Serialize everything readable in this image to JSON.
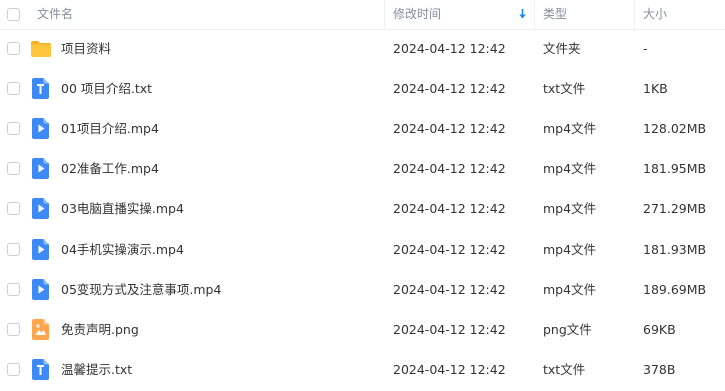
{
  "columns": {
    "name": "文件名",
    "modified": "修改时间",
    "type": "类型",
    "size": "大小"
  },
  "sort": {
    "column": "modified",
    "icon": "sort-down-arrow-icon",
    "color": "#1e88e5"
  },
  "colors": {
    "folder": "#ffc53d",
    "txt": "#3d8af7",
    "video": "#3d8af7",
    "image": "#ffa64d"
  },
  "files": [
    {
      "name": "项目资料",
      "modified": "2024-04-12 12:42",
      "type": "文件夹",
      "size": "-",
      "icon": "folder-icon"
    },
    {
      "name": "00 项目介绍.txt",
      "modified": "2024-04-12 12:42",
      "type": "txt文件",
      "size": "1KB",
      "icon": "txt-file-icon"
    },
    {
      "name": "01项目介绍.mp4",
      "modified": "2024-04-12 12:42",
      "type": "mp4文件",
      "size": "128.02MB",
      "icon": "video-file-icon"
    },
    {
      "name": "02准备工作.mp4",
      "modified": "2024-04-12 12:42",
      "type": "mp4文件",
      "size": "181.95MB",
      "icon": "video-file-icon"
    },
    {
      "name": "03电脑直播实操.mp4",
      "modified": "2024-04-12 12:42",
      "type": "mp4文件",
      "size": "271.29MB",
      "icon": "video-file-icon"
    },
    {
      "name": "04手机实操演示.mp4",
      "modified": "2024-04-12 12:42",
      "type": "mp4文件",
      "size": "181.93MB",
      "icon": "video-file-icon"
    },
    {
      "name": "05变现方式及注意事项.mp4",
      "modified": "2024-04-12 12:42",
      "type": "mp4文件",
      "size": "189.69MB",
      "icon": "video-file-icon"
    },
    {
      "name": "免责声明.png",
      "modified": "2024-04-12 12:42",
      "type": "png文件",
      "size": "69KB",
      "icon": "image-file-icon"
    },
    {
      "name": "温馨提示.txt",
      "modified": "2024-04-12 12:42",
      "type": "txt文件",
      "size": "378B",
      "icon": "txt-file-icon"
    }
  ]
}
